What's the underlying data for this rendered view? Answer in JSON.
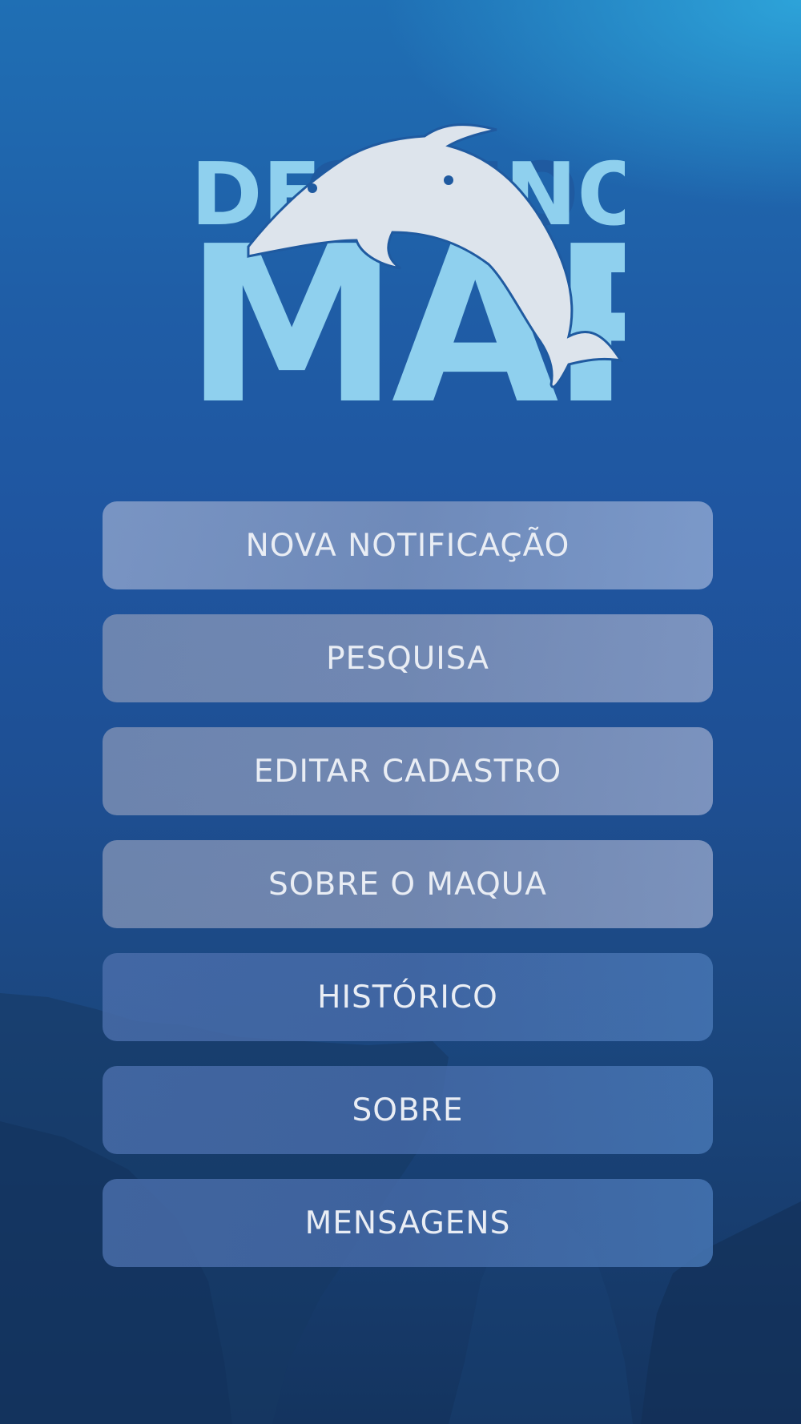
{
  "app": {
    "logo_alt": "De Olho no Mar"
  },
  "logo": {
    "line1_word1": "DE",
    "line1_word2": "OLHO",
    "line1_word3": "NO",
    "line2": "MAR",
    "text_color": "#8fd0ee",
    "dolphin_color": "#dde4ec"
  },
  "menu": {
    "items": [
      {
        "label": "NOVA NOTIFICAÇÃO",
        "style": "light"
      },
      {
        "label": "PESQUISA",
        "style": "light"
      },
      {
        "label": "EDITAR CADASTRO",
        "style": "light"
      },
      {
        "label": "SOBRE O MAQUA",
        "style": "light"
      },
      {
        "label": "HISTÓRICO",
        "style": "dark"
      },
      {
        "label": "SOBRE",
        "style": "dark"
      },
      {
        "label": "MENSAGENS",
        "style": "dark"
      }
    ]
  },
  "colors": {
    "background_top": "#1f6fb4",
    "background_bottom": "#14345f",
    "button_text": "#e9edf4"
  }
}
